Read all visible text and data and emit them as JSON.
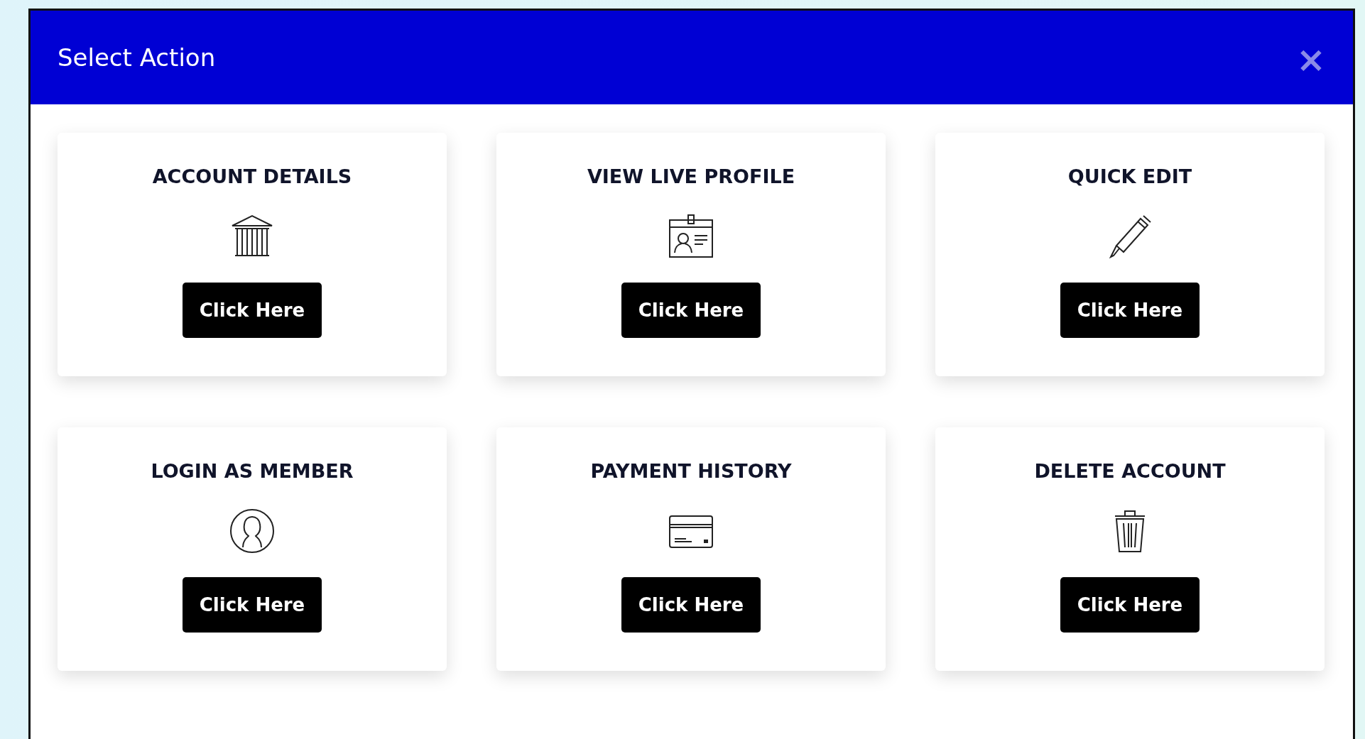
{
  "dialog": {
    "title": "Select Action",
    "close": "×"
  },
  "actions": [
    {
      "title": "ACCOUNT DETAILS",
      "button": "Click Here"
    },
    {
      "title": "VIEW LIVE PROFILE",
      "button": "Click Here"
    },
    {
      "title": "QUICK EDIT",
      "button": "Click Here"
    },
    {
      "title": "LOGIN AS MEMBER",
      "button": "Click Here"
    },
    {
      "title": "PAYMENT HISTORY",
      "button": "Click Here"
    },
    {
      "title": "DELETE ACCOUNT",
      "button": "Click Here"
    }
  ]
}
